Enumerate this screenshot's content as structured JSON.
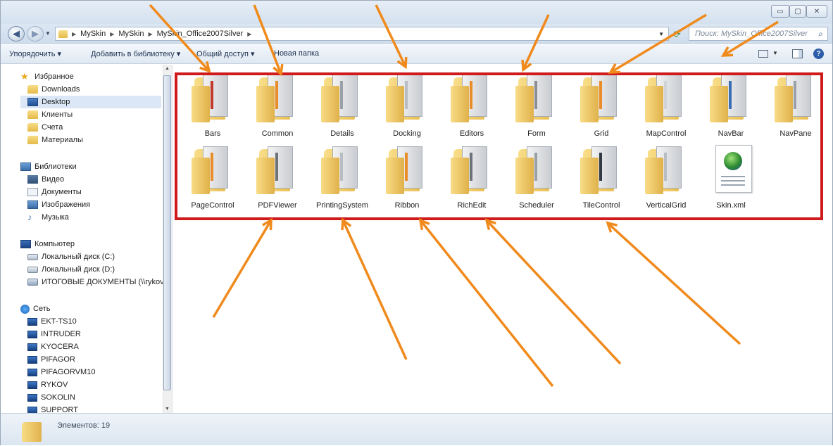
{
  "address": {
    "crumbs": [
      "MySkin",
      "MySkin",
      "MySkin_Office2007Silver"
    ]
  },
  "search": {
    "placeholder": "Поиск: MySkin_Office2007Silver"
  },
  "toolbar": {
    "organize": "Упорядочить ▾",
    "add_to_library": "Добавить в библиотеку ▾",
    "share": "Общий доступ ▾",
    "new_folder": "Новая папка"
  },
  "sidebar": {
    "favorites": "Избранное",
    "downloads": "Downloads",
    "desktop": "Desktop",
    "clients": "Клиенты",
    "accounts": "Счета",
    "materials": "Материалы",
    "libraries": "Библиотеки",
    "video": "Видео",
    "documents": "Документы",
    "images": "Изображения",
    "music": "Музыка",
    "computer": "Компьютер",
    "disk_c": "Локальный диск (C:)",
    "disk_d": "Локальный диск (D:)",
    "net_drive": "ИТОГОВЫЕ ДОКУМЕНТЫ (\\\\rykov) (Z",
    "network": "Сеть",
    "hosts": [
      "EKT-TS10",
      "INTRUDER",
      "KYOCERA",
      "PIFAGOR",
      "PIFAGORVM10",
      "RYKOV",
      "SOKOLIN",
      "SUPPORT"
    ]
  },
  "files": [
    "Bars",
    "Common",
    "Details",
    "Docking",
    "Editors",
    "Form",
    "Grid",
    "MapControl",
    "NavBar",
    "NavPane",
    "PageControl",
    "PDFViewer",
    "PrintingSystem",
    "Ribbon",
    "RichEdit",
    "Scheduler",
    "TileControl",
    "VerticalGrid",
    "Skin.xml"
  ],
  "status": {
    "count": "Элементов: 19"
  },
  "colors": {
    "highlight": "#cf1b1b",
    "arrow": "#f08a1c",
    "selection": "#dbe7f6"
  }
}
